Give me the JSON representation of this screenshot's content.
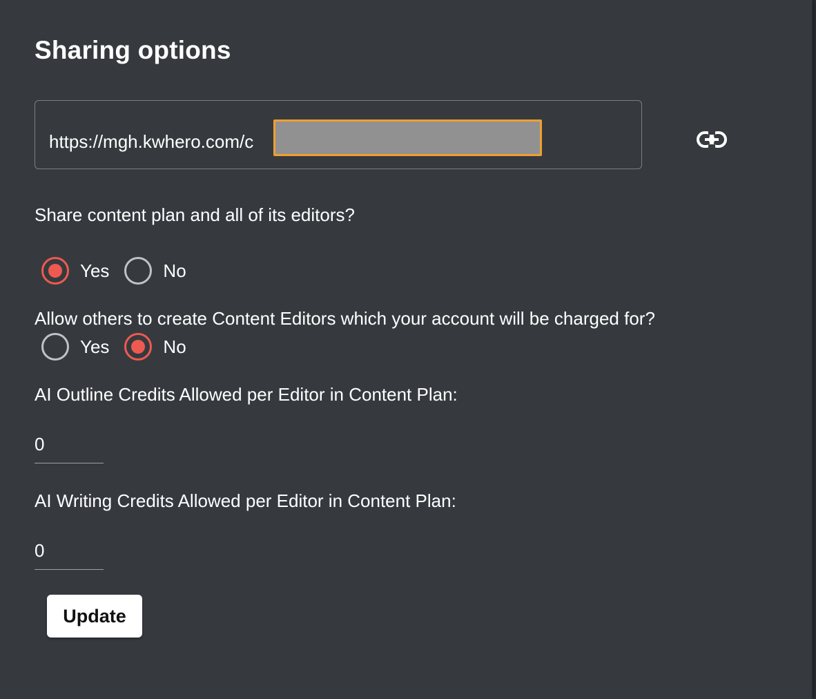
{
  "dialog": {
    "title": "Sharing options",
    "share_url": "https://mgh.kwhero.com/c",
    "link_icon": "link-icon"
  },
  "questions": {
    "share_plan": {
      "label": "Share content plan and all of its editors?",
      "options": [
        {
          "label": "Yes",
          "checked": true
        },
        {
          "label": "No",
          "checked": false
        }
      ]
    },
    "allow_create": {
      "label": "Allow others to create Content Editors which your account will be charged for?",
      "options": [
        {
          "label": "Yes",
          "checked": false
        },
        {
          "label": "No",
          "checked": true
        }
      ]
    },
    "outline_credits": {
      "label": "AI Outline Credits Allowed per Editor in Content Plan:",
      "value": "0"
    },
    "writing_credits": {
      "label": "AI Writing Credits Allowed per Editor in Content Plan:",
      "value": "0"
    }
  },
  "actions": {
    "update_label": "Update"
  },
  "colors": {
    "accent": "#ee5a50",
    "dialog_bg": "#363a3f",
    "redaction_border": "#f0a030"
  }
}
